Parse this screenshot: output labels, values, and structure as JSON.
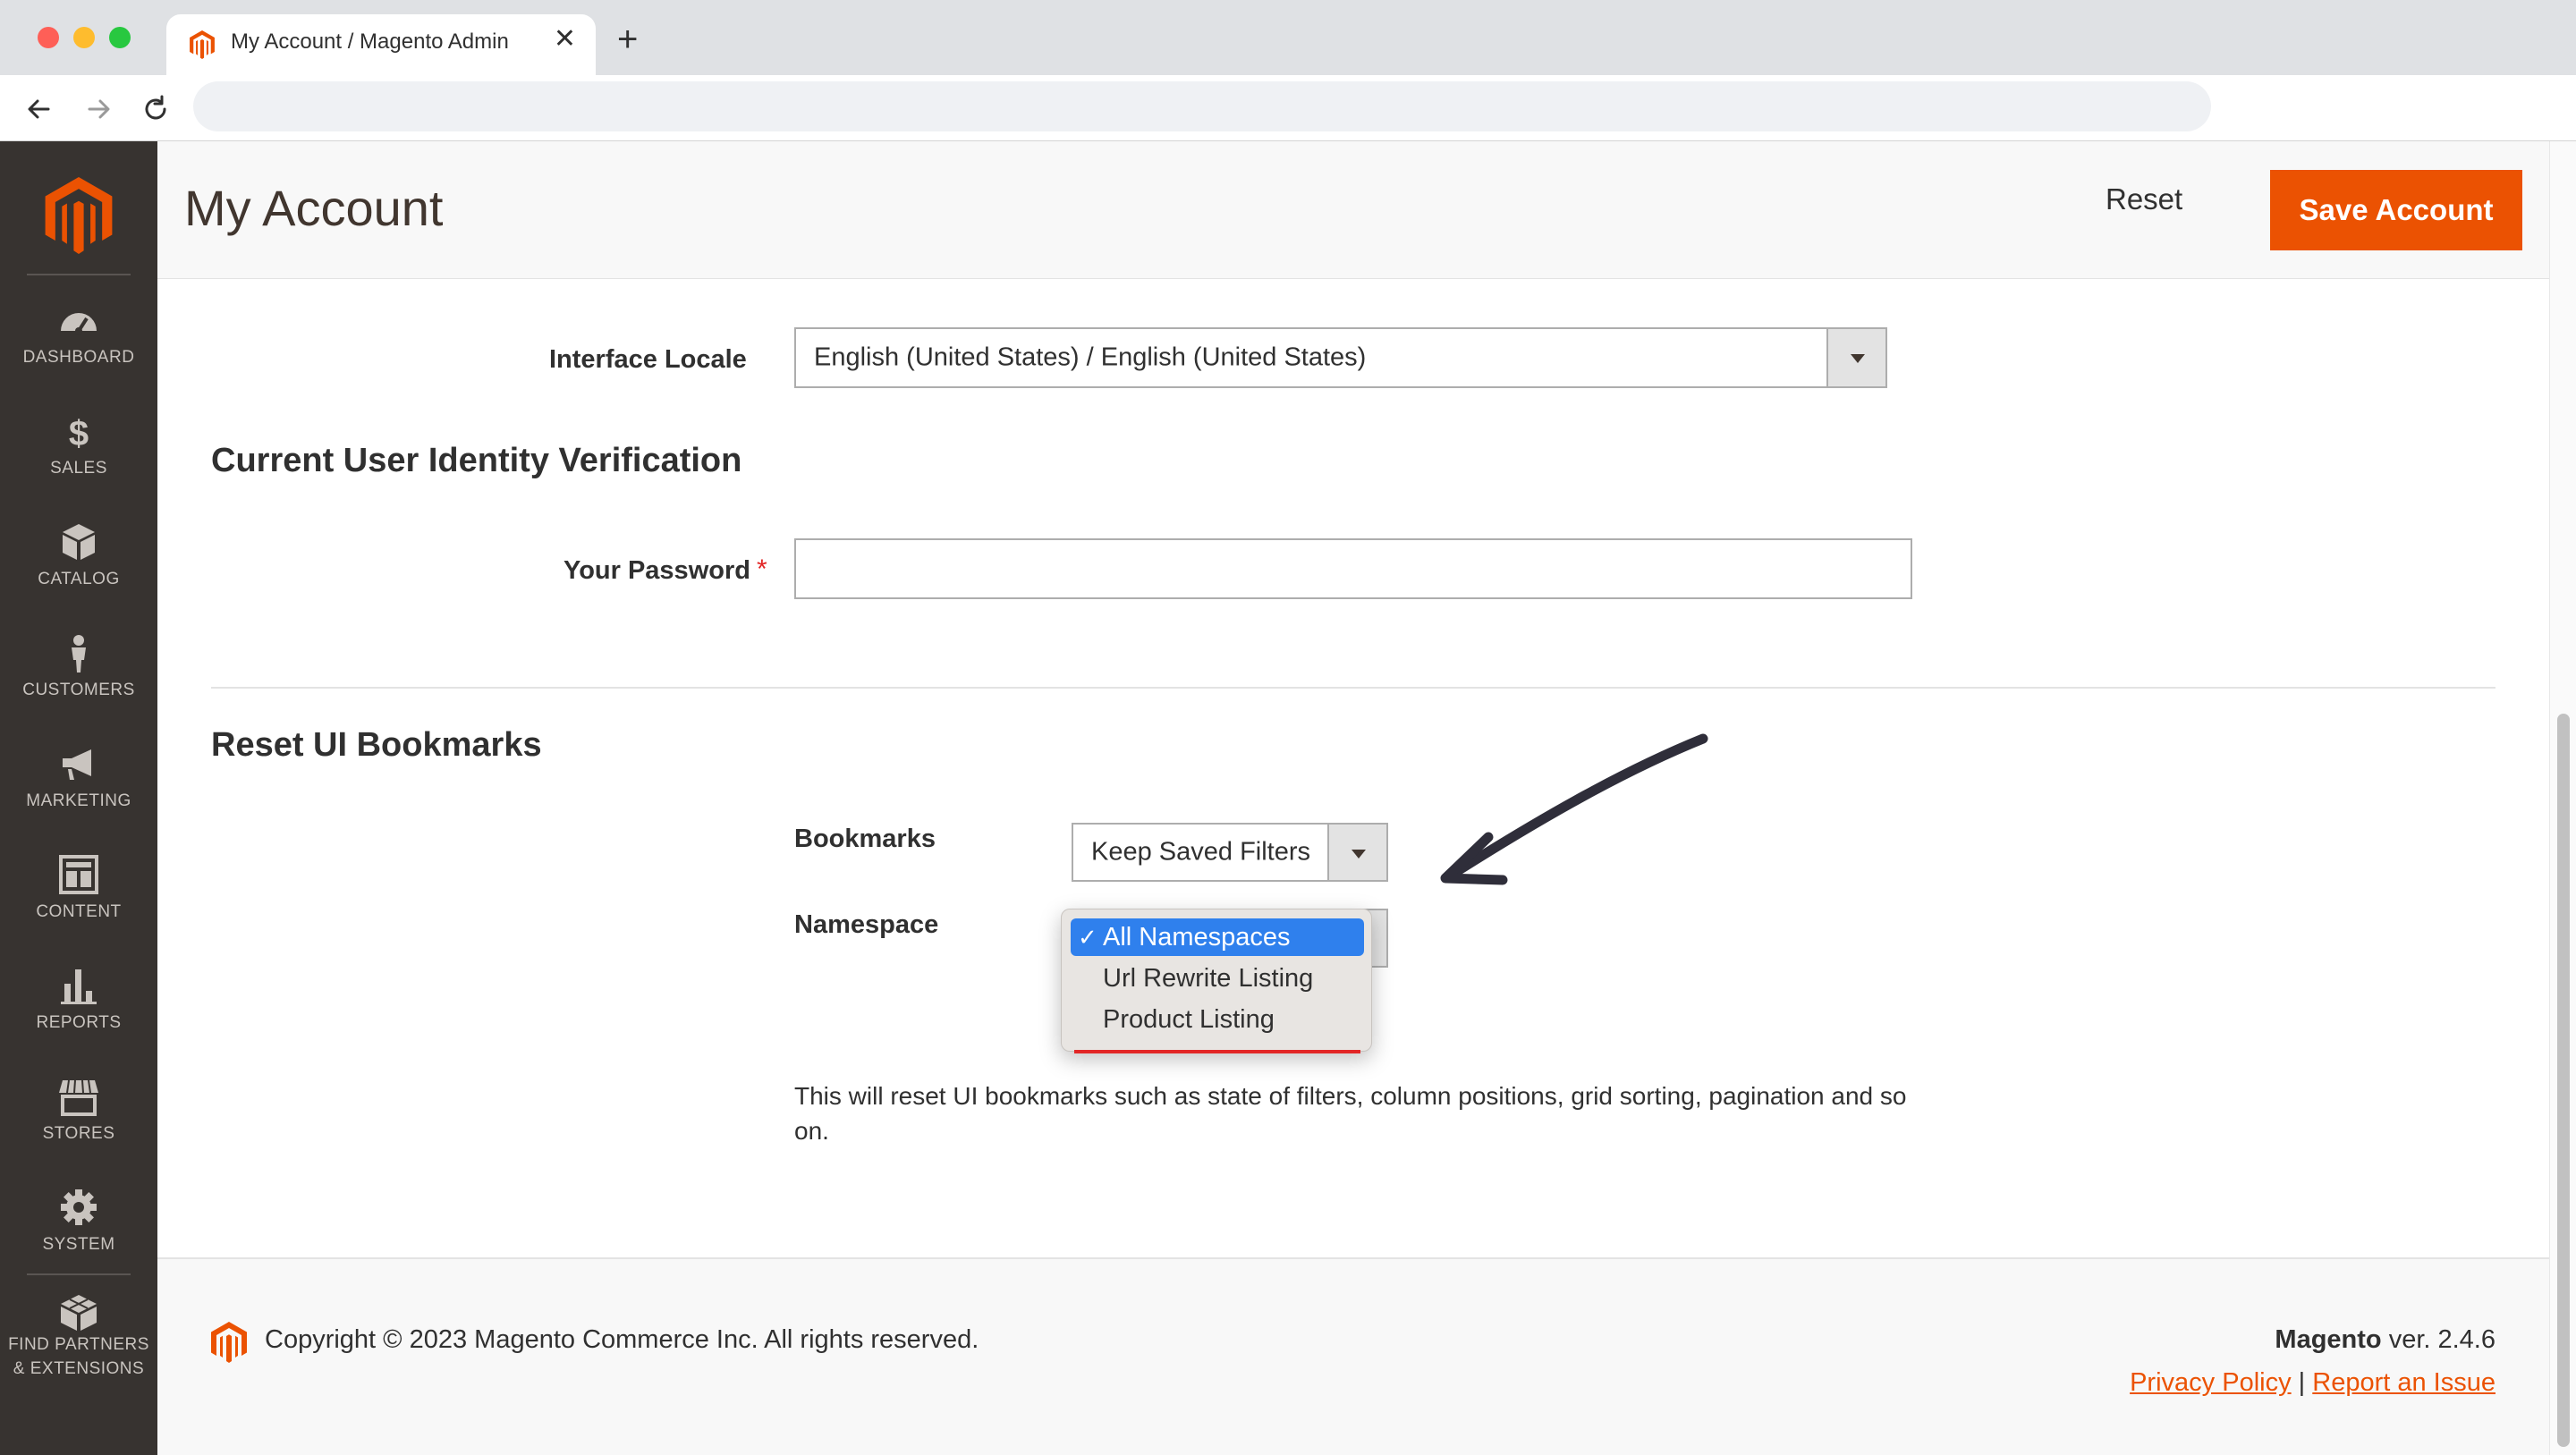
{
  "browser": {
    "tab_title": "My Account / Magento Admin",
    "tab_close": "✕",
    "new_tab": "+"
  },
  "sidebar": {
    "items": [
      {
        "label": "DASHBOARD",
        "icon": "dashboard-icon"
      },
      {
        "label": "SALES",
        "icon": "dollar-icon"
      },
      {
        "label": "CATALOG",
        "icon": "box-icon"
      },
      {
        "label": "CUSTOMERS",
        "icon": "person-icon"
      },
      {
        "label": "MARKETING",
        "icon": "megaphone-icon"
      },
      {
        "label": "CONTENT",
        "icon": "layout-icon"
      },
      {
        "label": "REPORTS",
        "icon": "bar-chart-icon"
      },
      {
        "label": "STORES",
        "icon": "storefront-icon"
      },
      {
        "label": "SYSTEM",
        "icon": "gear-icon"
      }
    ],
    "partners": {
      "line1": "FIND PARTNERS",
      "line2": "& EXTENSIONS",
      "icon": "cubes-icon"
    }
  },
  "header": {
    "title": "My Account",
    "reset_label": "Reset",
    "save_label": "Save Account"
  },
  "form": {
    "locale_label": "Interface Locale",
    "locale_value": "English (United States) / English (United States)",
    "verification_title": "Current User Identity Verification",
    "password_label": "Your Password",
    "password_value": "",
    "required_mark": "*",
    "bookmarks_section_title": "Reset UI Bookmarks",
    "bookmarks_label": "Bookmarks",
    "bookmarks_value": "Keep Saved Filters",
    "namespace_label": "Namespace",
    "namespace_options": [
      "All Namespaces",
      "Url Rewrite Listing",
      "Product Listing"
    ],
    "namespace_selected": "All Namespaces",
    "check_mark": "✓",
    "note": "This will reset UI bookmarks such as state of filters, column positions, grid sorting, pagination and so on."
  },
  "footer": {
    "copyright": "Copyright © 2023 Magento Commerce Inc. All rights reserved.",
    "brand": "Magento",
    "version": " ver. 2.4.6",
    "privacy_label": "Privacy Policy",
    "separator": "|",
    "report_label": "Report an Issue"
  },
  "colors": {
    "accent": "#eb5202",
    "sidebar_bg": "#373330",
    "selected_option": "#2f80ed"
  }
}
